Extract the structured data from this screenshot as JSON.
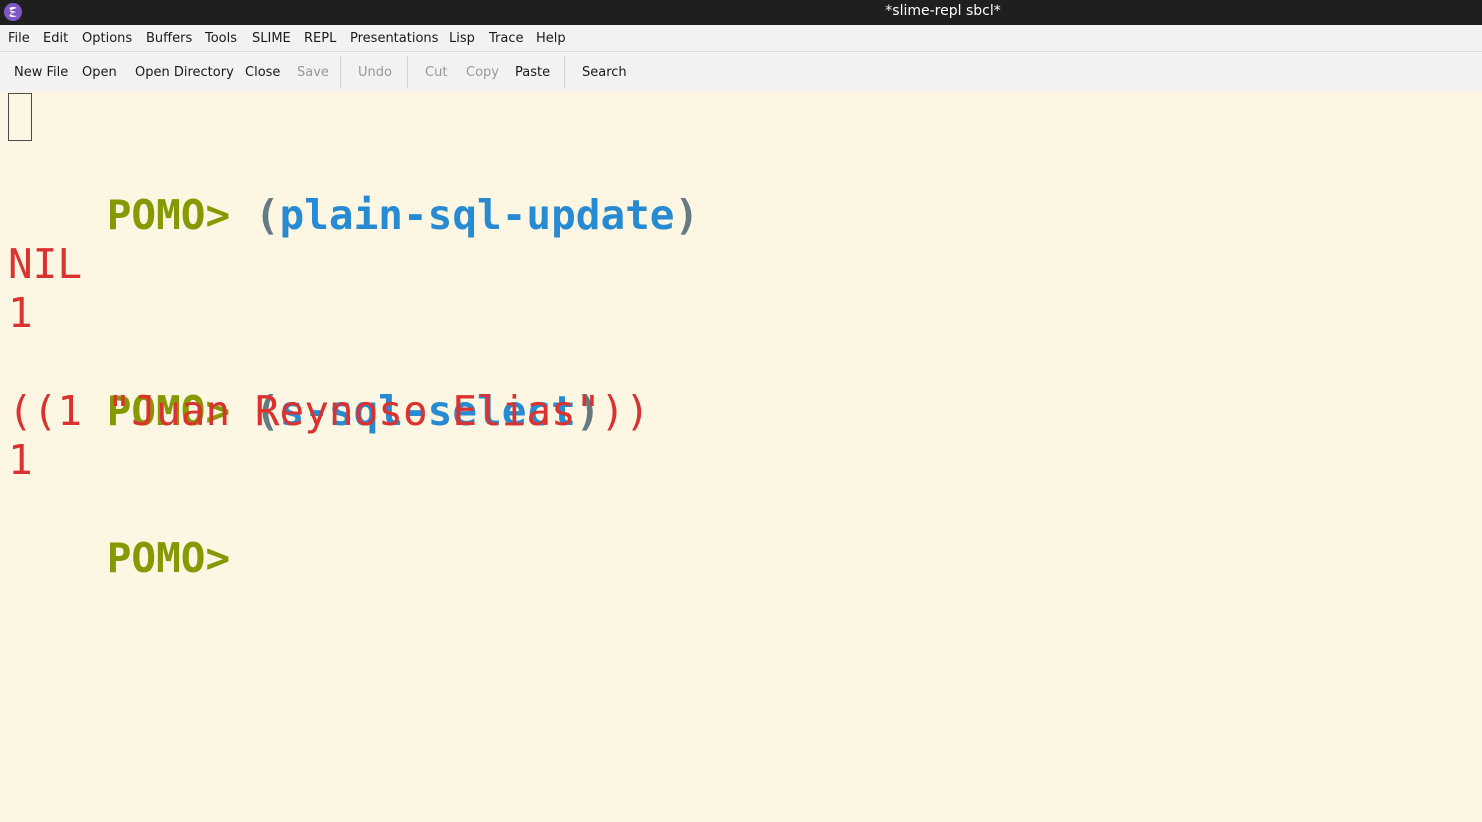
{
  "window": {
    "title": "*slime-repl sbcl*",
    "app_icon": "emacs-icon"
  },
  "menubar": {
    "items": [
      "File",
      "Edit",
      "Options",
      "Buffers",
      "Tools",
      "SLIME",
      "REPL",
      "Presentations",
      "Lisp",
      "Trace",
      "Help"
    ]
  },
  "toolbar": {
    "new_file": "New File",
    "open": "Open",
    "open_directory": "Open Directory",
    "close": "Close",
    "save": "Save",
    "undo": "Undo",
    "cut": "Cut",
    "copy": "Copy",
    "paste": "Paste",
    "search": "Search"
  },
  "repl": {
    "prompt": "POMO>",
    "cmd1": {
      "open": "(",
      "fn": "plain-sql-update",
      "close": ")"
    },
    "out1_a": "NIL",
    "out1_b": "1",
    "cmd2": {
      "open": "(",
      "fn": "s-sql-select",
      "close": ")"
    },
    "out2_a": "((1 \"Juan Reynoso Elias\"))",
    "out2_b": "1"
  },
  "colors": {
    "background": "#fdf6e3",
    "prompt": "#859900",
    "function": "#268bd2",
    "paren": "#657b83",
    "output": "#dc322f"
  }
}
